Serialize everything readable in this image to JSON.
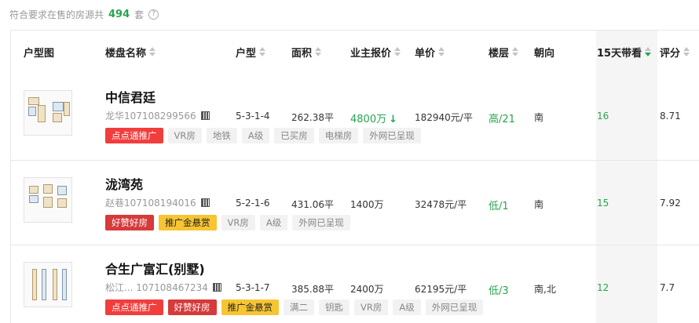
{
  "summary": {
    "prefix": "符合要求在售的房源共",
    "count": "494",
    "suffix": "套",
    "help_icon": "?"
  },
  "columns": [
    {
      "key": "plan",
      "label": "户型图",
      "sortable": false
    },
    {
      "key": "name",
      "label": "楼盘名称",
      "sortable": true
    },
    {
      "key": "layout",
      "label": "户型",
      "sortable": true
    },
    {
      "key": "area",
      "label": "面积",
      "sortable": true
    },
    {
      "key": "price",
      "label": "业主报价",
      "sortable": true
    },
    {
      "key": "unit",
      "label": "单价",
      "sortable": true
    },
    {
      "key": "floor",
      "label": "楼层",
      "sortable": true
    },
    {
      "key": "orient",
      "label": "朝向",
      "sortable": false
    },
    {
      "key": "views",
      "label": "15天带看",
      "sortable": true,
      "active": true
    },
    {
      "key": "score",
      "label": "评分",
      "sortable": true
    }
  ],
  "rows": [
    {
      "name": "中信君廷",
      "meta": "龙华107108299566",
      "layout": "5-3-1-4",
      "area": "262.38平",
      "price": "4800万",
      "price_down": "↓",
      "unit_price": "182940元/平",
      "floor": "高/21",
      "orient": "南",
      "views": "16",
      "score": "8.71",
      "tags": [
        "点点通推广",
        "VR房",
        "地铁",
        "A级",
        "已买房",
        "电梯房",
        "外网已呈现"
      ]
    },
    {
      "name": "泷湾苑",
      "meta": "赵巷107108194016",
      "layout": "5-2-1-6",
      "area": "431.06平",
      "price": "1400万",
      "unit_price": "32478元/平",
      "floor": "低/1",
      "orient": "南",
      "views": "15",
      "score": "7.92",
      "tags": [
        "好赞好房",
        "推广金悬赏",
        "VR房",
        "A级",
        "外网已呈现"
      ]
    },
    {
      "name": "合生广富汇(别墅)",
      "meta": "松江...  107108467234",
      "layout": "5-3-1-7",
      "area": "385.88平",
      "price": "2400万",
      "unit_price": "62195元/平",
      "floor": "低/3",
      "orient": "南,北",
      "views": "12",
      "score": "7.7",
      "tags": [
        "点点通推广",
        "好赞好房",
        "推广金悬赏",
        "满二",
        "钥匙",
        "VR房",
        "A级",
        "外网已呈现"
      ]
    }
  ],
  "colors": {
    "accent_green": "#27a54f",
    "tag_red": "#f23d3d",
    "tag_orange": "#f7c533"
  }
}
